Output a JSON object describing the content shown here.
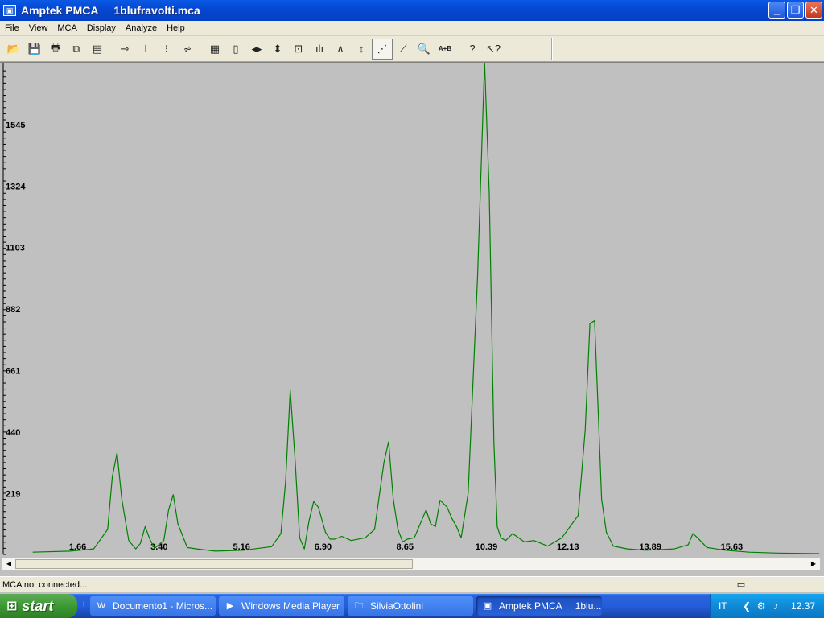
{
  "window": {
    "app_name": "Amptek PMCA",
    "file_name": "1blufravolti.mca",
    "title": "Amptek PMCA     1blufravolti.mca",
    "buttons": {
      "minimize": "_",
      "maximize": "❐",
      "close": "✕"
    }
  },
  "menu": [
    "File",
    "View",
    "MCA",
    "Display",
    "Analyze",
    "Help"
  ],
  "toolbar": {
    "ab_label": "A+B"
  },
  "chart_data": {
    "type": "line",
    "x_ticks": [
      "1.66",
      "3.40",
      "5.16",
      "6.90",
      "8.65",
      "10.39",
      "12.13",
      "13.89",
      "15.63"
    ],
    "y_ticks": [
      "219",
      "440",
      "661",
      "882",
      "1103",
      "1324",
      "1545"
    ],
    "ylim": [
      0,
      1750
    ],
    "xlim": [
      0.0,
      17.6
    ],
    "color": "#008000",
    "grid": false,
    "background": "#c0c0c0",
    "x": [
      0.7,
      1.5,
      2.0,
      2.3,
      2.4,
      2.5,
      2.6,
      2.75,
      2.9,
      3.0,
      3.1,
      3.2,
      3.3,
      3.5,
      3.6,
      3.7,
      3.8,
      4.0,
      4.2,
      4.6,
      5.2,
      5.8,
      6.0,
      6.1,
      6.2,
      6.3,
      6.4,
      6.5,
      6.6,
      6.7,
      6.8,
      6.95,
      7.05,
      7.15,
      7.3,
      7.5,
      7.8,
      8.0,
      8.2,
      8.3,
      8.4,
      8.5,
      8.6,
      8.7,
      8.85,
      9.1,
      9.2,
      9.3,
      9.4,
      9.55,
      9.65,
      9.75,
      9.85,
      10.0,
      10.2,
      10.35,
      10.45,
      10.55,
      10.62,
      10.7,
      10.8,
      10.95,
      11.2,
      11.4,
      11.7,
      12.0,
      12.35,
      12.5,
      12.6,
      12.7,
      12.78,
      12.85,
      12.95,
      13.1,
      13.4,
      13.8,
      14.4,
      14.7,
      14.8,
      14.9,
      15.1,
      15.5,
      16.0,
      16.6,
      17.5
    ],
    "y": [
      8,
      12,
      20,
      90,
      280,
      365,
      200,
      50,
      20,
      40,
      100,
      55,
      22,
      50,
      160,
      215,
      110,
      25,
      20,
      12,
      15,
      28,
      75,
      260,
      590,
      350,
      60,
      20,
      120,
      190,
      170,
      80,
      55,
      55,
      65,
      50,
      60,
      90,
      330,
      405,
      200,
      90,
      45,
      55,
      60,
      160,
      110,
      100,
      195,
      170,
      130,
      100,
      60,
      220,
      1000,
      1770,
      1300,
      400,
      100,
      60,
      50,
      75,
      45,
      50,
      30,
      60,
      140,
      450,
      830,
      840,
      500,
      200,
      80,
      30,
      20,
      15,
      20,
      35,
      75,
      60,
      25,
      15,
      8,
      5,
      3
    ]
  },
  "status": {
    "text": "MCA not connected..."
  },
  "taskbar": {
    "start_label": "start",
    "tasks": [
      {
        "label": "Documento1 - Micros...",
        "icon": "word-icon"
      },
      {
        "label": "Windows Media Player",
        "icon": "media-player-icon"
      },
      {
        "label": "SilviaOttolini",
        "icon": "folder-icon"
      },
      {
        "label": "Amptek PMCA     1blu...",
        "icon": "pmca-icon",
        "active": true
      }
    ],
    "language": "IT",
    "clock": "12.37"
  }
}
